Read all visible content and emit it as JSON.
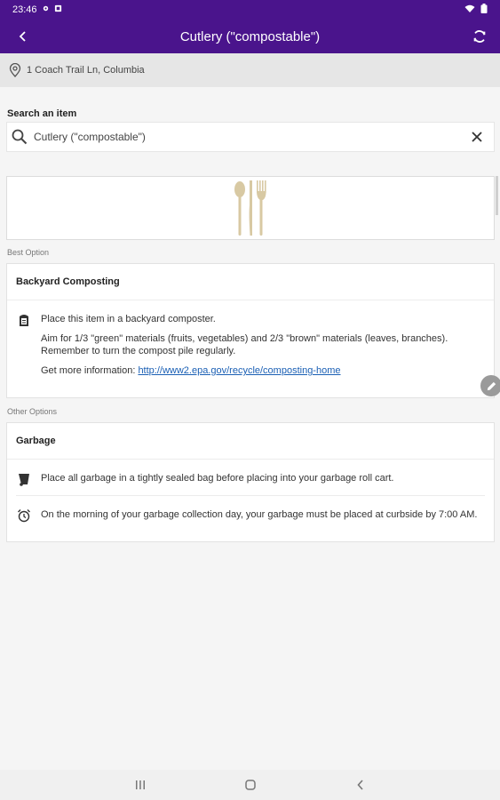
{
  "status_bar": {
    "time": "23:46"
  },
  "app_bar": {
    "title": "Cutlery (\"compostable\")"
  },
  "address": {
    "text": "1 Coach Trail Ln, Columbia"
  },
  "search": {
    "label": "Search an item",
    "value": "Cutlery (\"compostable\")"
  },
  "best_option": {
    "section_label": "Best Option",
    "title": "Backyard Composting",
    "line1": "Place this item in a backyard composter.",
    "line2": "Aim for 1/3 \"green\" materials (fruits, vegetables) and 2/3 \"brown\" materials (leaves, branches). Remember to turn the compost pile regularly.",
    "more_prefix": "Get more information: ",
    "more_link": "http://www2.epa.gov/recycle/composting-home",
    "icon": "composter-icon"
  },
  "other_options": {
    "section_label": "Other Options",
    "title": "Garbage",
    "items": [
      {
        "text": "Place all garbage in a tightly sealed bag before placing into your garbage roll cart.",
        "icon": "garbage-cart-icon"
      },
      {
        "text": "On the morning of your garbage collection day, your garbage must be placed at curbside by 7:00 AM.",
        "icon": "alarm-clock-icon"
      }
    ]
  },
  "colors": {
    "app_bar": "#4a148c",
    "link": "#1a5fb4",
    "utensil": "#d8c9a3"
  }
}
